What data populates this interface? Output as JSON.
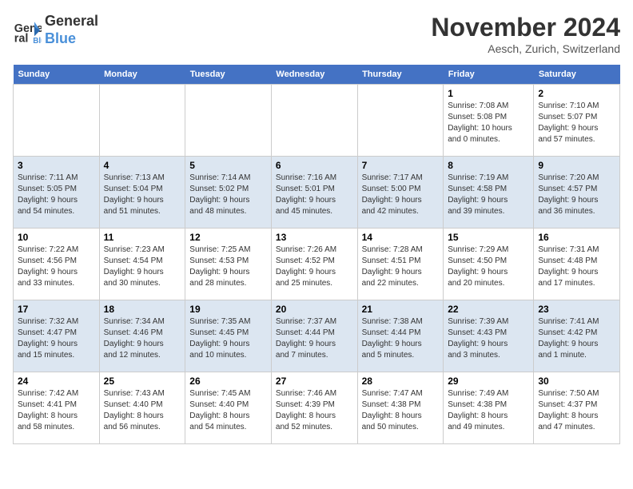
{
  "logo": {
    "line1": "General",
    "line2": "Blue"
  },
  "title": "November 2024",
  "location": "Aesch, Zurich, Switzerland",
  "weekdays": [
    "Sunday",
    "Monday",
    "Tuesday",
    "Wednesday",
    "Thursday",
    "Friday",
    "Saturday"
  ],
  "weeks": [
    [
      {
        "day": "",
        "info": ""
      },
      {
        "day": "",
        "info": ""
      },
      {
        "day": "",
        "info": ""
      },
      {
        "day": "",
        "info": ""
      },
      {
        "day": "",
        "info": ""
      },
      {
        "day": "1",
        "info": "Sunrise: 7:08 AM\nSunset: 5:08 PM\nDaylight: 10 hours\nand 0 minutes."
      },
      {
        "day": "2",
        "info": "Sunrise: 7:10 AM\nSunset: 5:07 PM\nDaylight: 9 hours\nand 57 minutes."
      }
    ],
    [
      {
        "day": "3",
        "info": "Sunrise: 7:11 AM\nSunset: 5:05 PM\nDaylight: 9 hours\nand 54 minutes."
      },
      {
        "day": "4",
        "info": "Sunrise: 7:13 AM\nSunset: 5:04 PM\nDaylight: 9 hours\nand 51 minutes."
      },
      {
        "day": "5",
        "info": "Sunrise: 7:14 AM\nSunset: 5:02 PM\nDaylight: 9 hours\nand 48 minutes."
      },
      {
        "day": "6",
        "info": "Sunrise: 7:16 AM\nSunset: 5:01 PM\nDaylight: 9 hours\nand 45 minutes."
      },
      {
        "day": "7",
        "info": "Sunrise: 7:17 AM\nSunset: 5:00 PM\nDaylight: 9 hours\nand 42 minutes."
      },
      {
        "day": "8",
        "info": "Sunrise: 7:19 AM\nSunset: 4:58 PM\nDaylight: 9 hours\nand 39 minutes."
      },
      {
        "day": "9",
        "info": "Sunrise: 7:20 AM\nSunset: 4:57 PM\nDaylight: 9 hours\nand 36 minutes."
      }
    ],
    [
      {
        "day": "10",
        "info": "Sunrise: 7:22 AM\nSunset: 4:56 PM\nDaylight: 9 hours\nand 33 minutes."
      },
      {
        "day": "11",
        "info": "Sunrise: 7:23 AM\nSunset: 4:54 PM\nDaylight: 9 hours\nand 30 minutes."
      },
      {
        "day": "12",
        "info": "Sunrise: 7:25 AM\nSunset: 4:53 PM\nDaylight: 9 hours\nand 28 minutes."
      },
      {
        "day": "13",
        "info": "Sunrise: 7:26 AM\nSunset: 4:52 PM\nDaylight: 9 hours\nand 25 minutes."
      },
      {
        "day": "14",
        "info": "Sunrise: 7:28 AM\nSunset: 4:51 PM\nDaylight: 9 hours\nand 22 minutes."
      },
      {
        "day": "15",
        "info": "Sunrise: 7:29 AM\nSunset: 4:50 PM\nDaylight: 9 hours\nand 20 minutes."
      },
      {
        "day": "16",
        "info": "Sunrise: 7:31 AM\nSunset: 4:48 PM\nDaylight: 9 hours\nand 17 minutes."
      }
    ],
    [
      {
        "day": "17",
        "info": "Sunrise: 7:32 AM\nSunset: 4:47 PM\nDaylight: 9 hours\nand 15 minutes."
      },
      {
        "day": "18",
        "info": "Sunrise: 7:34 AM\nSunset: 4:46 PM\nDaylight: 9 hours\nand 12 minutes."
      },
      {
        "day": "19",
        "info": "Sunrise: 7:35 AM\nSunset: 4:45 PM\nDaylight: 9 hours\nand 10 minutes."
      },
      {
        "day": "20",
        "info": "Sunrise: 7:37 AM\nSunset: 4:44 PM\nDaylight: 9 hours\nand 7 minutes."
      },
      {
        "day": "21",
        "info": "Sunrise: 7:38 AM\nSunset: 4:44 PM\nDaylight: 9 hours\nand 5 minutes."
      },
      {
        "day": "22",
        "info": "Sunrise: 7:39 AM\nSunset: 4:43 PM\nDaylight: 9 hours\nand 3 minutes."
      },
      {
        "day": "23",
        "info": "Sunrise: 7:41 AM\nSunset: 4:42 PM\nDaylight: 9 hours\nand 1 minute."
      }
    ],
    [
      {
        "day": "24",
        "info": "Sunrise: 7:42 AM\nSunset: 4:41 PM\nDaylight: 8 hours\nand 58 minutes."
      },
      {
        "day": "25",
        "info": "Sunrise: 7:43 AM\nSunset: 4:40 PM\nDaylight: 8 hours\nand 56 minutes."
      },
      {
        "day": "26",
        "info": "Sunrise: 7:45 AM\nSunset: 4:40 PM\nDaylight: 8 hours\nand 54 minutes."
      },
      {
        "day": "27",
        "info": "Sunrise: 7:46 AM\nSunset: 4:39 PM\nDaylight: 8 hours\nand 52 minutes."
      },
      {
        "day": "28",
        "info": "Sunrise: 7:47 AM\nSunset: 4:38 PM\nDaylight: 8 hours\nand 50 minutes."
      },
      {
        "day": "29",
        "info": "Sunrise: 7:49 AM\nSunset: 4:38 PM\nDaylight: 8 hours\nand 49 minutes."
      },
      {
        "day": "30",
        "info": "Sunrise: 7:50 AM\nSunset: 4:37 PM\nDaylight: 8 hours\nand 47 minutes."
      }
    ]
  ]
}
